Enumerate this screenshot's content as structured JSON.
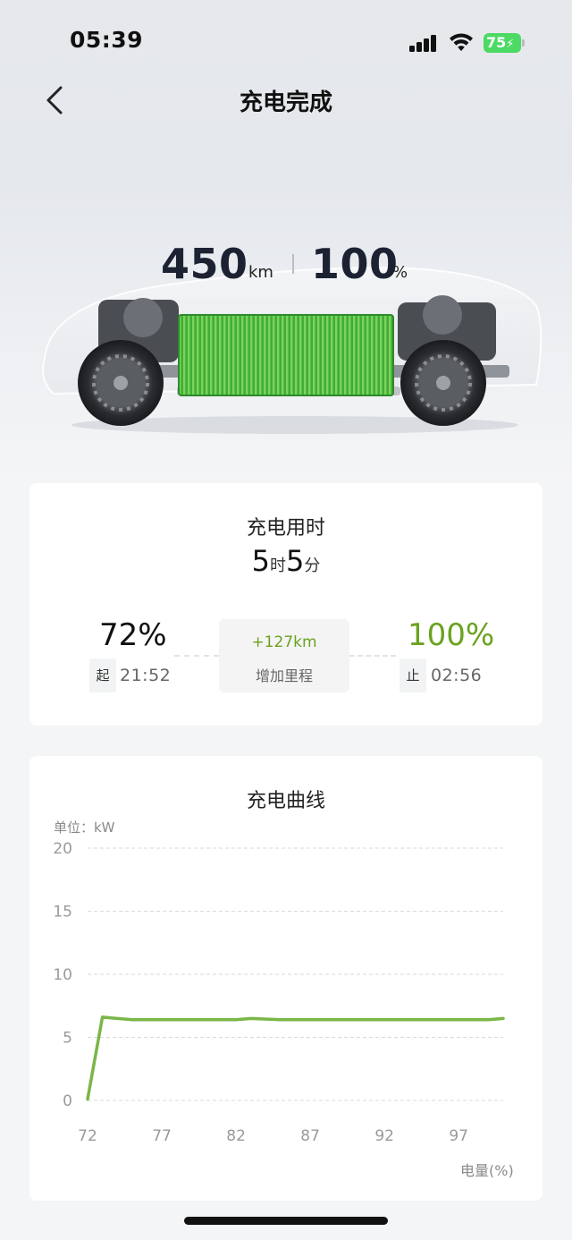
{
  "status_bar": {
    "time": "05:39",
    "battery": "75"
  },
  "nav": {
    "title": "充电完成"
  },
  "range": {
    "distance": "450",
    "distance_unit": "km",
    "soc": "100",
    "soc_unit": "%"
  },
  "charge": {
    "title": "充电用时",
    "hours": "5",
    "hours_unit": "时",
    "minutes": "5",
    "minutes_unit": "分",
    "start": {
      "percent": "72%",
      "tag": "起",
      "time": "21:52"
    },
    "end": {
      "percent": "100%",
      "tag": "止",
      "time": "02:56"
    },
    "added": {
      "value": "+127km",
      "label": "增加里程"
    },
    "colors": {
      "accent_green": "#6aa220"
    }
  },
  "curve": {
    "title": "充电曲线",
    "unit_label": "单位：kW",
    "xlabel": "电量(%)"
  },
  "chart_data": {
    "type": "line",
    "ylabel": "单位：kW",
    "xlabel": "电量(%)",
    "ylim": [
      0,
      20
    ],
    "xlim": [
      72,
      100
    ],
    "yticks": [
      0,
      5,
      10,
      15,
      20
    ],
    "xticks": [
      72,
      77,
      82,
      87,
      92,
      97
    ],
    "grid": true,
    "color": "#7ab648",
    "series": [
      {
        "x": [
          72,
          73,
          75,
          77,
          80,
          82,
          83,
          85,
          88,
          92,
          97,
          99,
          100
        ],
        "y": [
          0.1,
          6.6,
          6.4,
          6.4,
          6.4,
          6.4,
          6.5,
          6.4,
          6.4,
          6.4,
          6.4,
          6.4,
          6.5
        ]
      }
    ]
  }
}
